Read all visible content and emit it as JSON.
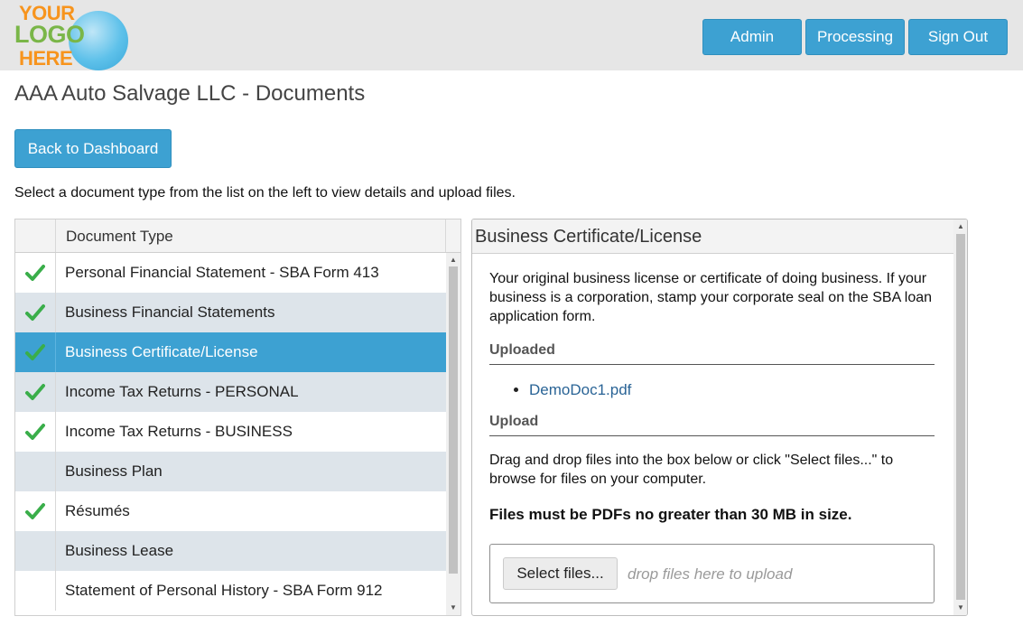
{
  "logo": {
    "line1": "YOUR",
    "line2": "LOGO",
    "line3": "HERE"
  },
  "nav": {
    "admin": "Admin",
    "processing": "Processing",
    "sign_out": "Sign Out"
  },
  "page": {
    "title": "AAA Auto Salvage LLC - Documents",
    "back_label": "Back to Dashboard",
    "instructions": "Select a document type from the list on the left to view details and upload files."
  },
  "grid": {
    "column_header": "Document Type",
    "rows": [
      {
        "label": "Personal Financial Statement - SBA Form 413",
        "checked": true
      },
      {
        "label": "Business Financial Statements",
        "checked": true
      },
      {
        "label": "Business Certificate/License",
        "checked": true,
        "selected": true
      },
      {
        "label": "Income Tax Returns - PERSONAL",
        "checked": true
      },
      {
        "label": "Income Tax Returns - BUSINESS",
        "checked": true
      },
      {
        "label": "Business Plan",
        "checked": false
      },
      {
        "label": "Résumés",
        "checked": true
      },
      {
        "label": "Business Lease",
        "checked": false
      },
      {
        "label": "Statement of Personal History - SBA Form 912",
        "checked": false
      }
    ]
  },
  "detail": {
    "title": "Business Certificate/License",
    "description": "Your original business license or certificate of doing business. If your business is a corporation, stamp your corporate seal on the SBA loan application form.",
    "uploaded_label": "Uploaded",
    "uploaded_files": [
      "DemoDoc1.pdf"
    ],
    "upload_label": "Upload",
    "upload_instructions": "Drag and drop files into the box below or click \"Select files...\" to browse for files on your computer.",
    "upload_rule": "Files must be PDFs no greater than 30 MB in size.",
    "select_files_label": "Select files...",
    "drop_hint": "drop files here to upload"
  },
  "colors": {
    "accent": "#3da1d2",
    "check": "#3aae4a",
    "alt_row": "#dde4ea",
    "link": "#2a6496"
  }
}
